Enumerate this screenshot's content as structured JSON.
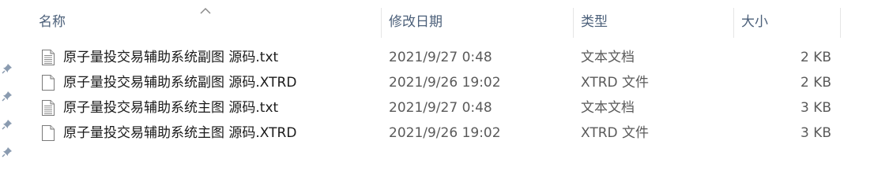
{
  "columns": {
    "name": "名称",
    "date": "修改日期",
    "type": "类型",
    "size": "大小"
  },
  "sort": {
    "column": "name",
    "direction": "ascending",
    "icon": "chevron-up-icon"
  },
  "files": [
    {
      "name": "原子量投交易辅助系统副图 源码.txt",
      "date": "2021/9/27 0:48",
      "type": "文本文档",
      "size": "2 KB",
      "icon": "text-file-icon"
    },
    {
      "name": "原子量投交易辅助系统副图 源码.XTRD",
      "date": "2021/9/26 19:02",
      "type": "XTRD 文件",
      "size": "2 KB",
      "icon": "blank-file-icon"
    },
    {
      "name": "原子量投交易辅助系统主图 源码.txt",
      "date": "2021/9/27 0:48",
      "type": "文本文档",
      "size": "3 KB",
      "icon": "text-file-icon"
    },
    {
      "name": "原子量投交易辅助系统主图 源码.XTRD",
      "date": "2021/9/26 19:02",
      "type": "XTRD 文件",
      "size": "3 KB",
      "icon": "blank-file-icon"
    }
  ],
  "nav_pins": [
    "pin-icon",
    "pin-icon",
    "pin-icon",
    "pin-icon"
  ]
}
